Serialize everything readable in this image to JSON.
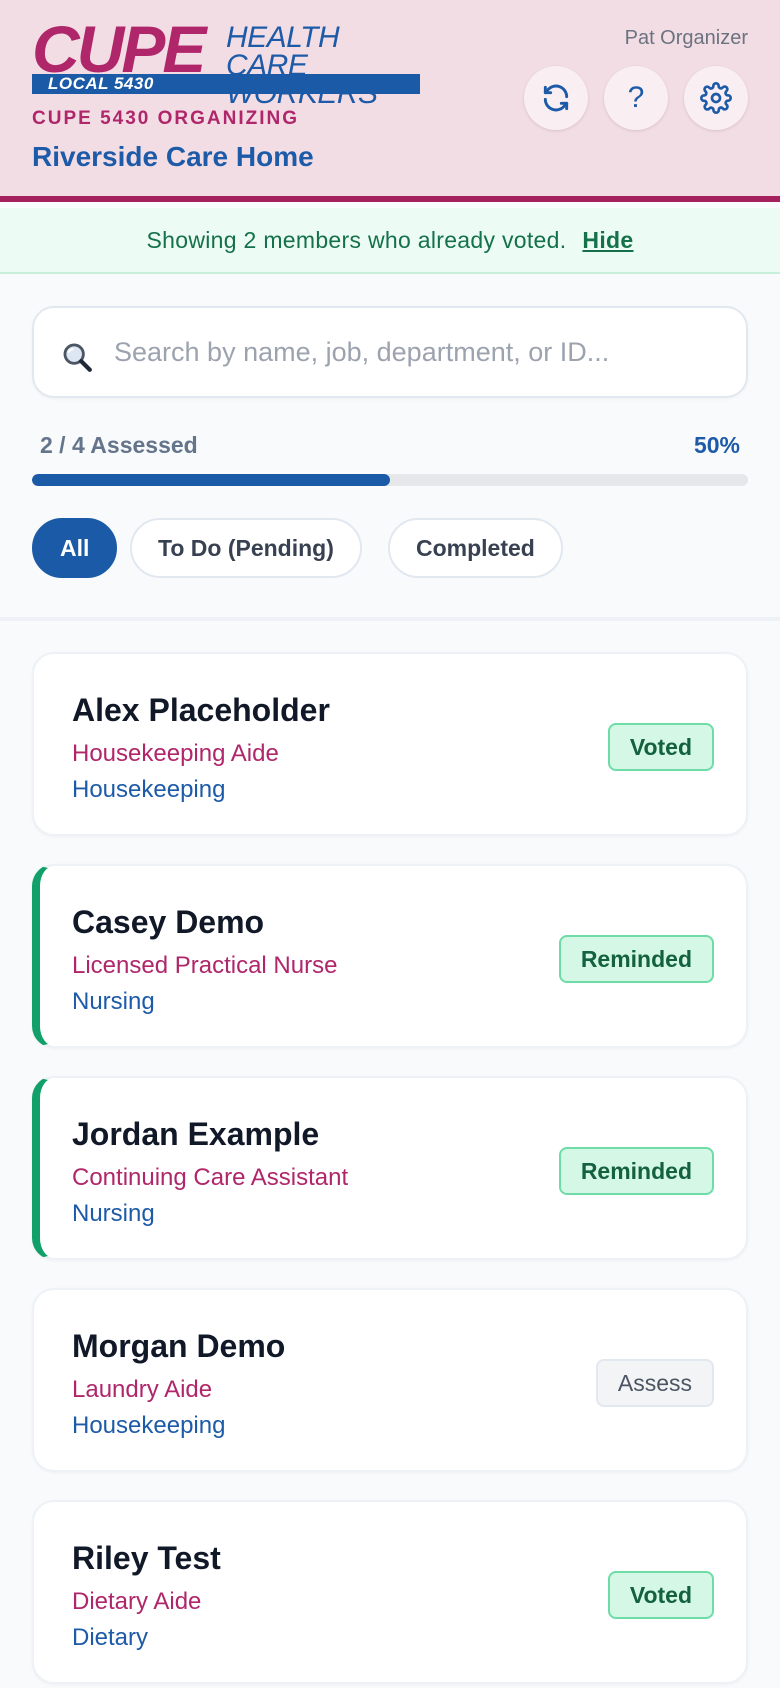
{
  "header": {
    "logo_main": "CUPE",
    "logo_line1": "HEALTH CARE",
    "logo_line2": "WORKERS",
    "logo_local": "LOCAL 5430",
    "org_label": "CUPE 5430 ORGANIZING",
    "site_name": "Riverside Care Home",
    "user_name": "Pat Organizer",
    "icons": [
      "refresh-icon",
      "help-icon",
      "gear-icon"
    ],
    "help_glyph": "?"
  },
  "banner": {
    "message": "Showing 2 members who already voted.",
    "hide_label": "Hide"
  },
  "search": {
    "placeholder": "Search by name, job, department, or ID...",
    "value": ""
  },
  "progress": {
    "label": "2 / 4 Assessed",
    "percent_label": "50%",
    "fraction": 0.5
  },
  "filters": [
    {
      "label": "All",
      "active": true
    },
    {
      "label": "To Do (Pending)",
      "active": false
    },
    {
      "label": "Completed",
      "active": false
    }
  ],
  "members": [
    {
      "name": "Alex Placeholder",
      "job": "Housekeeping Aide",
      "department": "Housekeeping",
      "status": "Voted"
    },
    {
      "name": "Casey Demo",
      "job": "Licensed Practical Nurse",
      "department": "Nursing",
      "status": "Reminded"
    },
    {
      "name": "Jordan Example",
      "job": "Continuing Care Assistant",
      "department": "Nursing",
      "status": "Reminded"
    },
    {
      "name": "Morgan Demo",
      "job": "Laundry Aide",
      "department": "Housekeeping",
      "status": "Assess"
    },
    {
      "name": "Riley Test",
      "job": "Dietary Aide",
      "department": "Dietary",
      "status": "Voted"
    }
  ],
  "colors": {
    "brand_magenta": "#b0266a",
    "brand_blue": "#1a5aa6",
    "success_green": "#12a06a",
    "header_bg": "#f3dde4"
  }
}
